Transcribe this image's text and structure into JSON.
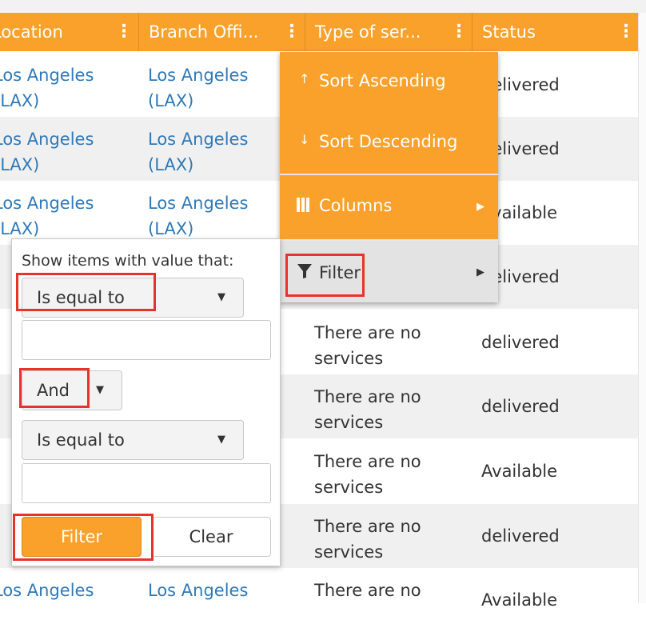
{
  "grid": {
    "columns": [
      {
        "label": "Location"
      },
      {
        "label": "Branch Offi..."
      },
      {
        "label": "Type of ser..."
      },
      {
        "label": "Status"
      }
    ],
    "rows": [
      {
        "location": "Los Angeles (LAX)",
        "branch": "Los Angeles (LAX)",
        "type": "",
        "status": "delivered"
      },
      {
        "location": "Los Angeles (LAX)",
        "branch": "Los Angeles (LAX)",
        "type": "",
        "status": "delivered"
      },
      {
        "location": "Los Angeles (LAX)",
        "branch": "Los Angeles (LAX)",
        "type": "",
        "status": "Available"
      },
      {
        "location": "",
        "branch": "",
        "type": "",
        "status": "delivered"
      },
      {
        "location": "",
        "branch": "",
        "type": "There are no services",
        "status": "delivered"
      },
      {
        "location": "",
        "branch": "",
        "type": "There are no services",
        "status": "delivered"
      },
      {
        "location": "",
        "branch": "",
        "type": "There are no services",
        "status": "Available"
      },
      {
        "location": "",
        "branch": "",
        "type": "There are no services",
        "status": "delivered"
      },
      {
        "location": "Los Angeles",
        "branch": "Los Angeles",
        "type": "There are no",
        "status": "Available"
      }
    ]
  },
  "column_menu": {
    "sort_ascending": "Sort Ascending",
    "sort_descending": "Sort Descending",
    "columns": "Columns",
    "filter": "Filter"
  },
  "filter_panel": {
    "title": "Show items with value that:",
    "operator1": "Is equal to",
    "value1": "",
    "logic": "And",
    "operator2": "Is equal to",
    "value2": "",
    "filter_button": "Filter",
    "clear_button": "Clear"
  },
  "colors": {
    "header": "#f9a12b",
    "link": "#2f79b9",
    "highlight": "#e8332a"
  }
}
